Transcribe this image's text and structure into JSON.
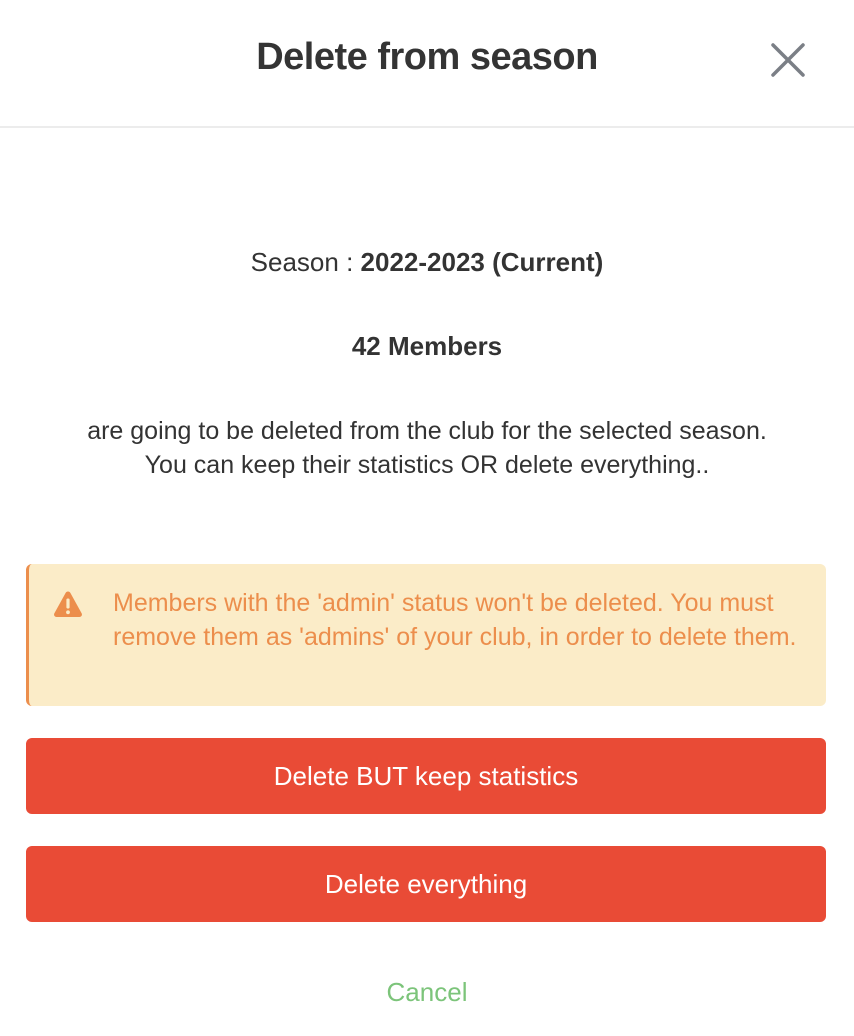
{
  "header": {
    "title": "Delete from season",
    "close_icon": "close-icon"
  },
  "season": {
    "label": "Season : ",
    "value": "2022-2023 (Current)"
  },
  "members": {
    "count_text": "42 Members"
  },
  "description": "are going to be deleted from the club for the selected season. You can keep their statistics OR delete everything..",
  "warning": {
    "icon": "warning-icon",
    "text": "Members with the 'admin' status won't be deleted. You must remove them as 'admins' of your club, in order to delete them.",
    "color": "#ec8e4c",
    "background": "#fbecc8"
  },
  "actions": {
    "keep_stats_label": "Delete BUT keep statistics",
    "delete_all_label": "Delete everything",
    "cancel_label": "Cancel",
    "danger_color": "#e94b36",
    "cancel_color": "#7cc47a"
  }
}
